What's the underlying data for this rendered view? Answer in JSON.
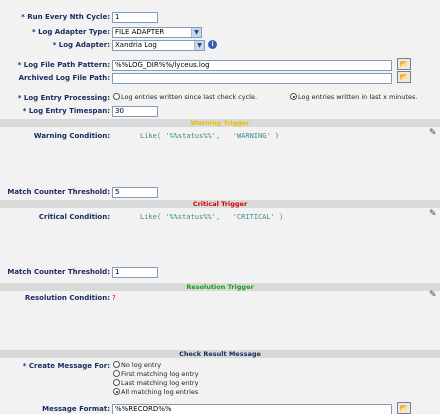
{
  "fields": {
    "run_every_label": "* Run Every Nth Cycle:",
    "run_every_value": "1",
    "adapter_type_label": "* Log Adapter Type:",
    "adapter_type_value": "FILE ADAPTER",
    "adapter_label": "* Log Adapter:",
    "adapter_value": "Xandria Log",
    "path_pattern_label": "* Log File Path Pattern:",
    "path_pattern_value": "%%LOG_DIR%%/lyceus.log",
    "archived_label": "Archived Log File Path:",
    "archived_value": "",
    "processing_label": "* Log Entry Processing:",
    "processing_opt1": "Log entries written since last check cycle.",
    "processing_opt2": "Log entries written in last x minutes.",
    "timespan_label": "* Log Entry Timespan:",
    "timespan_value": "30"
  },
  "warning": {
    "header": "Warning Trigger",
    "header_color": "#e6c000",
    "condition_label": "Warning Condition:",
    "condition_value": "Like('%%status%%', 'WARNING')",
    "threshold_label": "Match Counter Threshold:",
    "threshold_value": "5"
  },
  "critical": {
    "header": "Critical Trigger",
    "header_color": "#d40000",
    "condition_label": "Critical Condition:",
    "condition_value": "Like('%%status%%', 'CRITICAL')",
    "threshold_label": "Match Counter Threshold:",
    "threshold_value": "1"
  },
  "resolution": {
    "header": "Resolution Trigger",
    "header_color": "#1a9e1a",
    "condition_label": "Resolution Condition:",
    "condition_value": "?"
  },
  "message": {
    "header": "Check Result Message",
    "create_label": "* Create Message For:",
    "options": [
      "No log entry",
      "First matching log entry",
      "Last matching log entry",
      "All matching log entries"
    ],
    "format_label": "Message Format:",
    "format_value": "%%RECORD%%"
  },
  "icons": {
    "dropdown": "chevron-down-icon",
    "info": "info-icon",
    "browse": "browse-icon",
    "edit": "edit-pencil-icon"
  }
}
